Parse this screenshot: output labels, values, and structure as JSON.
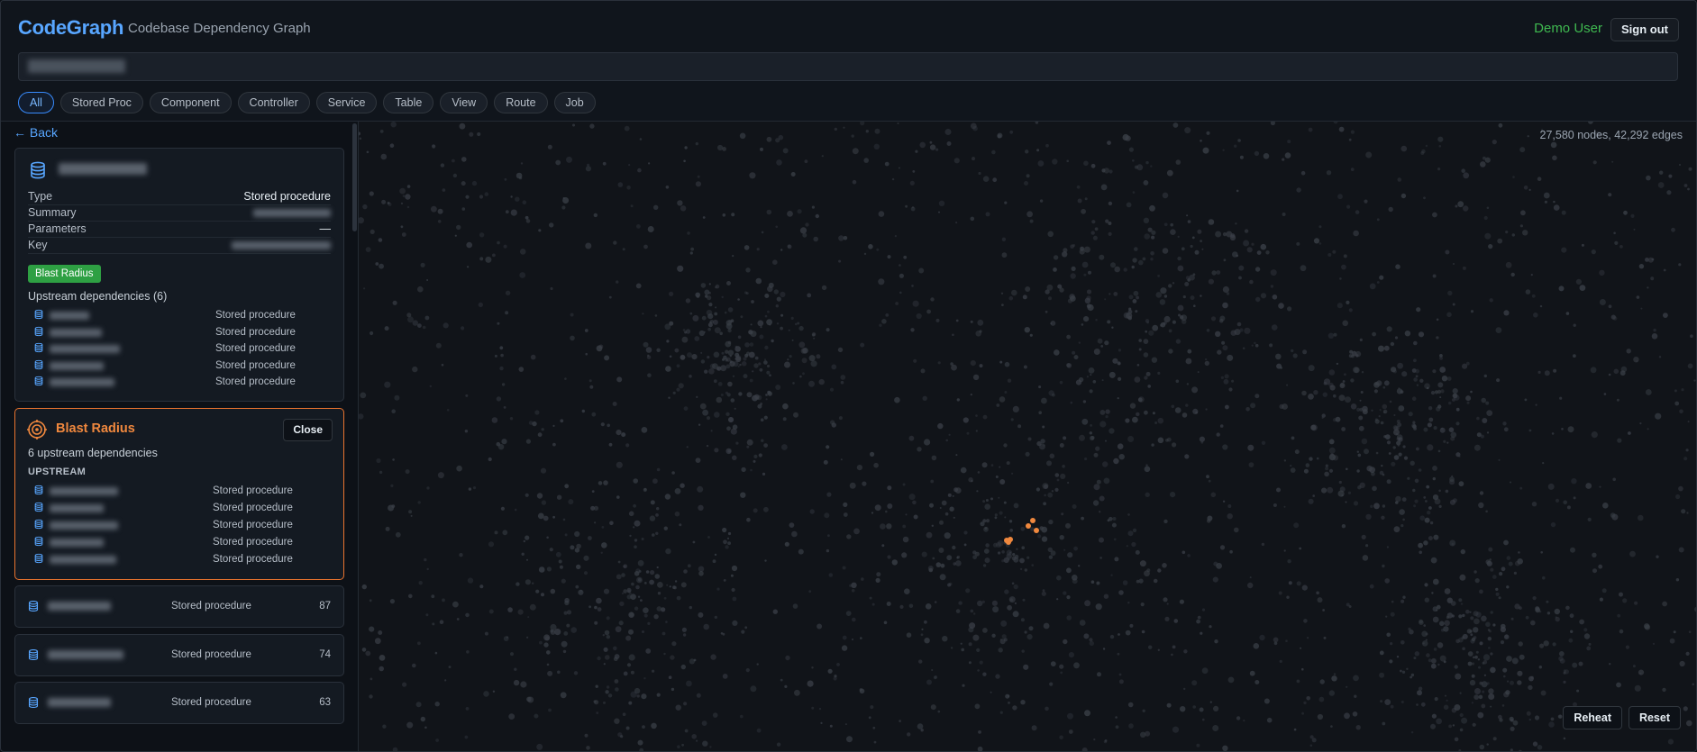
{
  "header": {
    "brand": "CodeGraph",
    "subtitle": "Codebase Dependency Graph",
    "user": "Demo User",
    "sign_out": "Sign out"
  },
  "filters": [
    "All",
    "Stored Proc",
    "Component",
    "Controller",
    "Service",
    "Table",
    "View",
    "Route",
    "Job"
  ],
  "active_filter": "All",
  "sidebar": {
    "back": "← Back",
    "details": {
      "fields": [
        {
          "label": "Type",
          "value": "Stored procedure"
        },
        {
          "label": "Summary",
          "value": ""
        },
        {
          "label": "Parameters",
          "value": "—"
        },
        {
          "label": "Key",
          "value": ""
        }
      ],
      "blast_radius_button": "Blast Radius",
      "upstream_title": "Upstream dependencies (6)",
      "upstream": [
        "Stored procedure",
        "Stored procedure",
        "Stored procedure",
        "Stored procedure",
        "Stored procedure"
      ]
    },
    "blast_radius": {
      "title": "Blast Radius",
      "close": "Close",
      "summary": "6 upstream dependencies",
      "section": "UPSTREAM",
      "items": [
        "Stored procedure",
        "Stored procedure",
        "Stored procedure",
        "Stored procedure",
        "Stored procedure"
      ]
    },
    "list": [
      {
        "type": "Stored procedure",
        "count": "87"
      },
      {
        "type": "Stored procedure",
        "count": "74"
      },
      {
        "type": "Stored procedure",
        "count": "63"
      }
    ]
  },
  "graph": {
    "stats": "27,580 nodes, 42,292 edges",
    "reheat": "Reheat",
    "reset": "Reset",
    "highlight_color": "#f0883e",
    "node_color": "#3a3f47"
  },
  "colors": {
    "accent": "#58a6ff",
    "success": "#2ea043",
    "warning": "#f0883e"
  }
}
